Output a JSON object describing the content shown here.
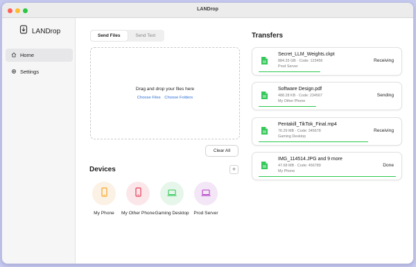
{
  "window": {
    "title": "LANDrop"
  },
  "sidebar": {
    "app_name": "LANDrop",
    "items": [
      {
        "label": "Home",
        "icon": "home-icon",
        "active": true
      },
      {
        "label": "Settings",
        "icon": "gear-icon",
        "active": false
      }
    ]
  },
  "send": {
    "tabs": [
      {
        "label": "Send Files",
        "active": true
      },
      {
        "label": "Send Text",
        "active": false
      }
    ],
    "drop_label": "Drag and drop your files here",
    "choose_files": "Choose Files",
    "choose_folders": "Choose Folders",
    "clear_all": "Clear All"
  },
  "devices": {
    "title": "Devices",
    "add_label": "+",
    "items": [
      {
        "name": "My Phone",
        "icon": "phone-icon",
        "color": "#f5a623",
        "bg": "#fbf1e4"
      },
      {
        "name": "My Other Phone",
        "icon": "phone-icon",
        "color": "#e83a57",
        "bg": "#fbe7ea"
      },
      {
        "name": "Gaming Desktop",
        "icon": "laptop-icon",
        "color": "#34c759",
        "bg": "#e6f6ea"
      },
      {
        "name": "Prod Server",
        "icon": "laptop-icon",
        "color": "#b33cc4",
        "bg": "#f3e6f6"
      }
    ]
  },
  "transfers": {
    "title": "Transfers",
    "items": [
      {
        "name": "Secret_LLM_Weights.ckpt",
        "meta": "884.33 GB · Code: 123456",
        "device": "Prod Server",
        "status": "Receiving",
        "progress": 0.45
      },
      {
        "name": "Software Design.pdf",
        "meta": "488.28 KB · Code: 234567",
        "device": "My Other Phone",
        "status": "Sending",
        "progress": 0.42
      },
      {
        "name": "Pentakill_TikTok_Final.mp4",
        "meta": "76.29 MB · Code: 345678",
        "device": "Gaming Desktop",
        "status": "Receiving",
        "progress": 0.8
      },
      {
        "name": "IMG_114514.JPG and 9 more",
        "meta": "47.68 MB · Code: 456789",
        "device": "My Phone",
        "status": "Done",
        "progress": 1.0
      }
    ]
  },
  "colors": {
    "accent": "#2f6fd6",
    "progress": "#29c84a",
    "file_icon": "#34c759"
  }
}
